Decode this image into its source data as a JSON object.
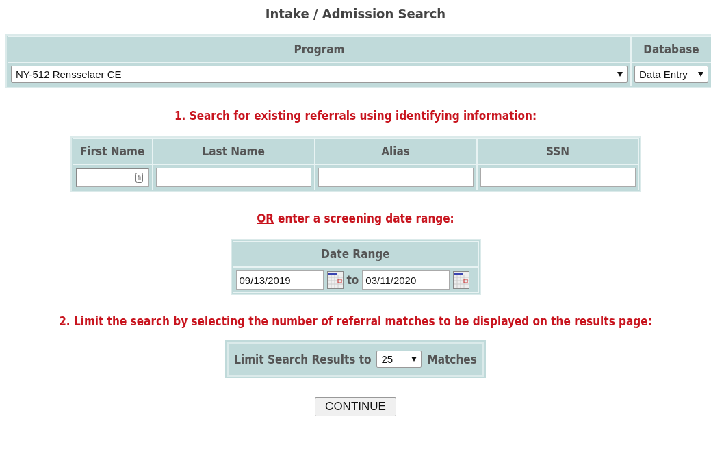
{
  "title": "Intake / Admission Search",
  "program_table": {
    "columns": [
      "Program",
      "Database"
    ],
    "program_value": "NY-512 Rensselaer CE",
    "database_value": "Data Entry"
  },
  "step1": "1. Search for existing referrals using identifying information:",
  "name_table": {
    "columns": [
      "First Name",
      "Last Name",
      "Alias",
      "SSN"
    ]
  },
  "or_line": {
    "link": "OR",
    "text": "enter a screening date range:"
  },
  "date_range": {
    "label": "Date Range",
    "from": "09/13/2019",
    "separator": "to",
    "to": "03/11/2020"
  },
  "step2": "2. Limit the search by selecting the number of referral matches to be displayed on the results page:",
  "limit": {
    "label": "Limit Search Results to",
    "value": "25",
    "suffix": "Matches"
  },
  "continue_button": "CONTINUE"
}
